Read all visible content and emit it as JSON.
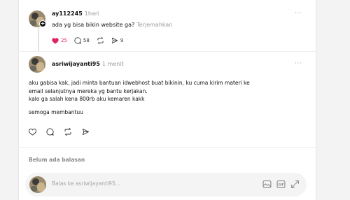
{
  "parent_post": {
    "username": "ay112245",
    "time": "1hari",
    "text": "ada yg bisa bikin website ga?",
    "translate_label": "Terjemahkan",
    "more_label": "···",
    "likes": "25",
    "comments": "58",
    "reposts": "",
    "shares": "9"
  },
  "reply_post": {
    "username": "asriwijayanti95",
    "time": "1 menit",
    "more_label": "···",
    "lines": [
      "aku gabisa kak, jadi minta bantuan idwebhost buat bikinin, ku cuma kirim materi ke",
      "email selanjutnya mereka yg bantu kerjakan.",
      "kalo ga salah kena 800rb aku kemaren kakk"
    ],
    "closing": "semoga membantuu"
  },
  "no_replies_label": "Belum ada balasan",
  "reply_input": {
    "placeholder": "Balas ke asriwijayanti95..."
  },
  "colors": {
    "like_red": "#e0245e",
    "muted": "#9a9a9a",
    "background": "#f3f3f3"
  }
}
